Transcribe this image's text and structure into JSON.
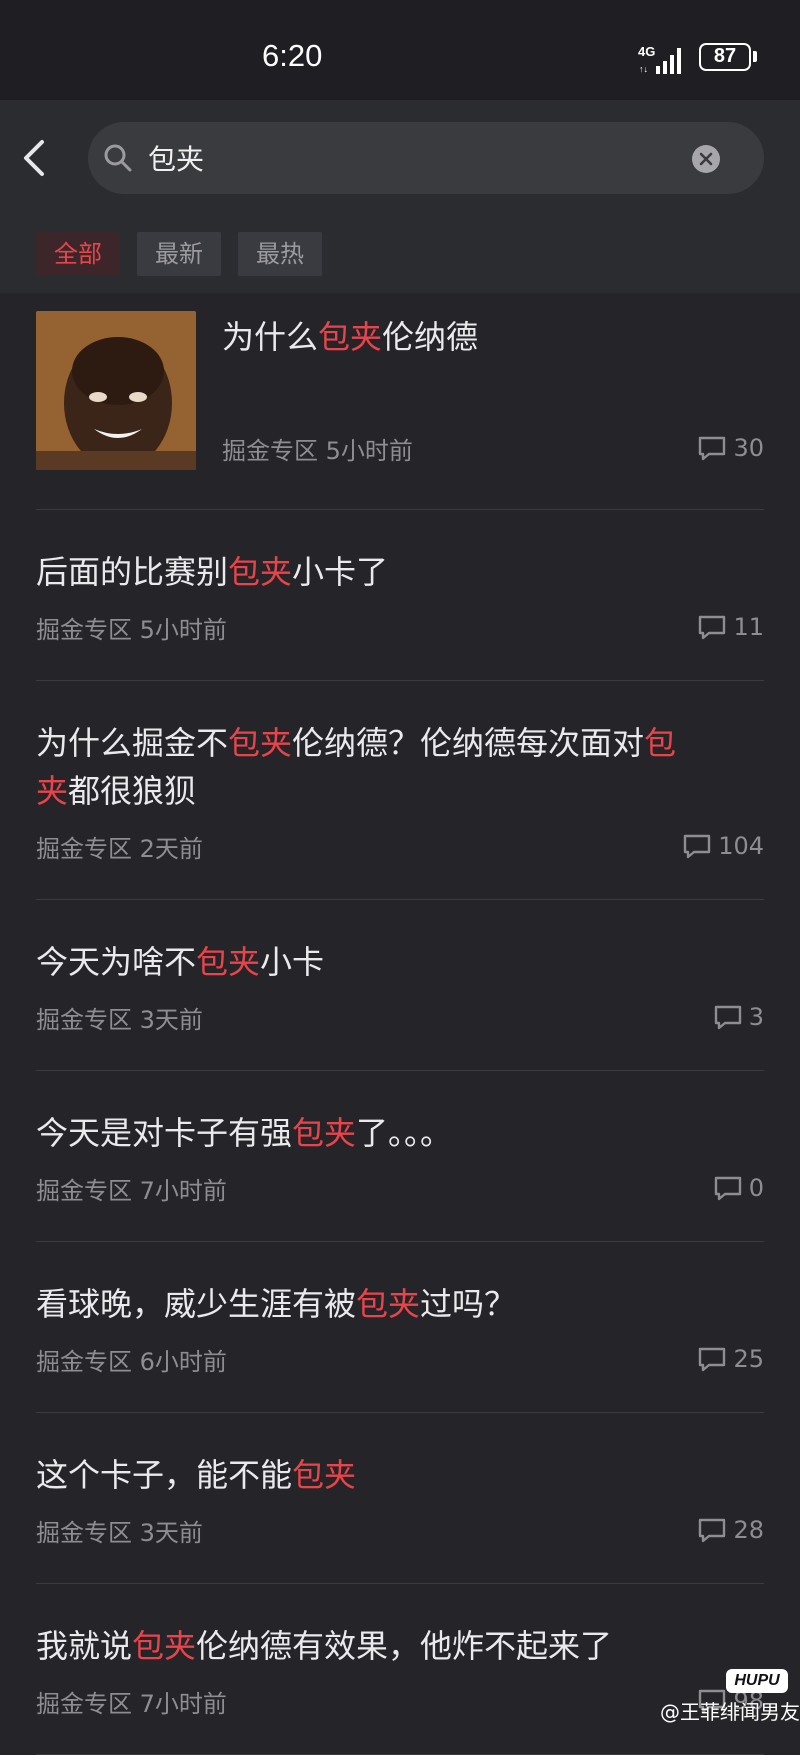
{
  "status_bar": {
    "time": "6:20",
    "network": "4G",
    "battery": "87"
  },
  "search": {
    "query": "包夹",
    "placeholder": ""
  },
  "tabs": [
    {
      "label": "全部",
      "active": true
    },
    {
      "label": "最新",
      "active": false
    },
    {
      "label": "最热",
      "active": false
    }
  ],
  "results": [
    {
      "title_parts": [
        "为什么",
        "包夹",
        "伦纳德"
      ],
      "forum": "掘金专区",
      "time": "5小时前",
      "comments": "30",
      "has_thumbnail": true
    },
    {
      "title_parts": [
        "后面的比赛别",
        "包夹",
        "小卡了"
      ],
      "forum": "掘金专区",
      "time": "5小时前",
      "comments": "11"
    },
    {
      "title_parts": [
        "为什么掘金不",
        "包夹",
        "伦纳德？伦纳德每次面对",
        "包",
        "",
        "夹",
        "都很狼狈"
      ],
      "forum": "掘金专区",
      "time": "2天前",
      "comments": "104"
    },
    {
      "title_parts": [
        "今天为啥不",
        "包夹",
        "小卡"
      ],
      "forum": "掘金专区",
      "time": "3天前",
      "comments": "3"
    },
    {
      "title_parts": [
        "今天是对卡子有强",
        "包夹",
        "了。。。"
      ],
      "forum": "掘金专区",
      "time": "7小时前",
      "comments": "0"
    },
    {
      "title_parts": [
        "看球晚，威少生涯有被",
        "包夹",
        "过吗？"
      ],
      "forum": "掘金专区",
      "time": "6小时前",
      "comments": "25"
    },
    {
      "title_parts": [
        "这个卡子，能不能",
        "包夹"
      ],
      "forum": "掘金专区",
      "time": "3天前",
      "comments": "28"
    },
    {
      "title_parts": [
        "我就说",
        "包夹",
        "伦纳德有效果，他炸不起来了"
      ],
      "forum": "掘金专区",
      "time": "7小时前",
      "comments": "98"
    }
  ],
  "colors": {
    "highlight": "#e8454b",
    "background": "#242429",
    "meta": "#8d8d92"
  },
  "watermark": {
    "logo": "HUPU",
    "text": "@王菲绯闻男友"
  }
}
